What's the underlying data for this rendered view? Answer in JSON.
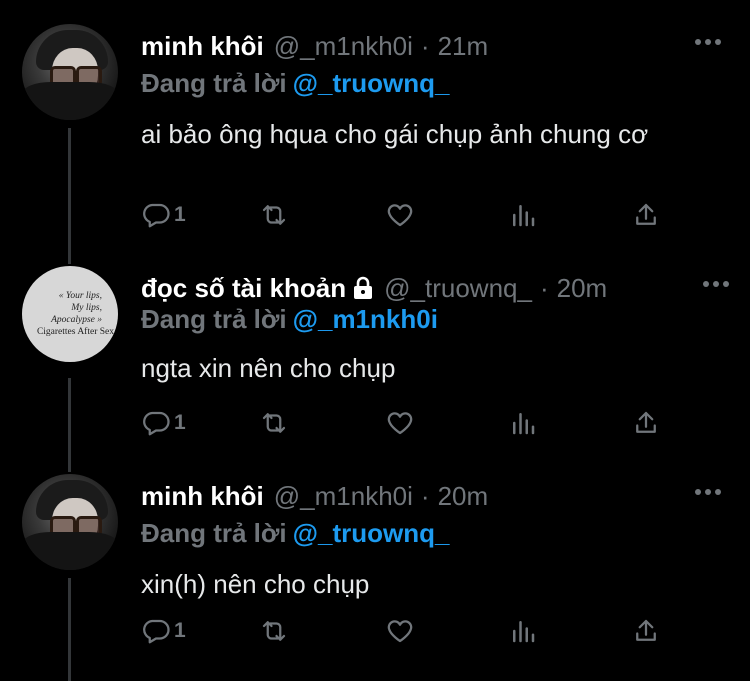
{
  "tweets": [
    {
      "name": "minh khôi",
      "handle": "@_m1nkh0i",
      "dot": "·",
      "time": "21m",
      "replying_label": "Đang trả lời",
      "replying_to": "@_truownq_",
      "text": "ai bảo ông hqua cho gái chụp ảnh chung cơ",
      "reply_count": "1",
      "avatar": "photo"
    },
    {
      "name": "đọc số tài khoản",
      "handle": "@_truownq_",
      "dot": "·",
      "time": "20m",
      "replying_label": "Đang trả lời",
      "replying_to": "@_m1nkh0i",
      "text": "ngta xin nên cho chụp",
      "reply_count": "1",
      "avatar": "text",
      "avatar_lines": [
        "« Your lips,",
        "My lips,",
        "Apocalypse »",
        "Cigarettes After Sex"
      ]
    },
    {
      "name": "minh khôi",
      "handle": "@_m1nkh0i",
      "dot": "·",
      "time": "20m",
      "replying_label": "Đang trả lời",
      "replying_to": "@_truownq_",
      "text": "xin(h) nên cho chụp",
      "reply_count": "1",
      "avatar": "photo"
    }
  ],
  "icons": [
    "reply-icon",
    "retweet-icon",
    "like-icon",
    "analytics-icon",
    "share-icon",
    "more-icon",
    "lock-icon"
  ],
  "colors": {
    "background": "#000000",
    "accent": "#1d9bf0",
    "muted": "#71767b",
    "text": "#e7e9ea"
  }
}
